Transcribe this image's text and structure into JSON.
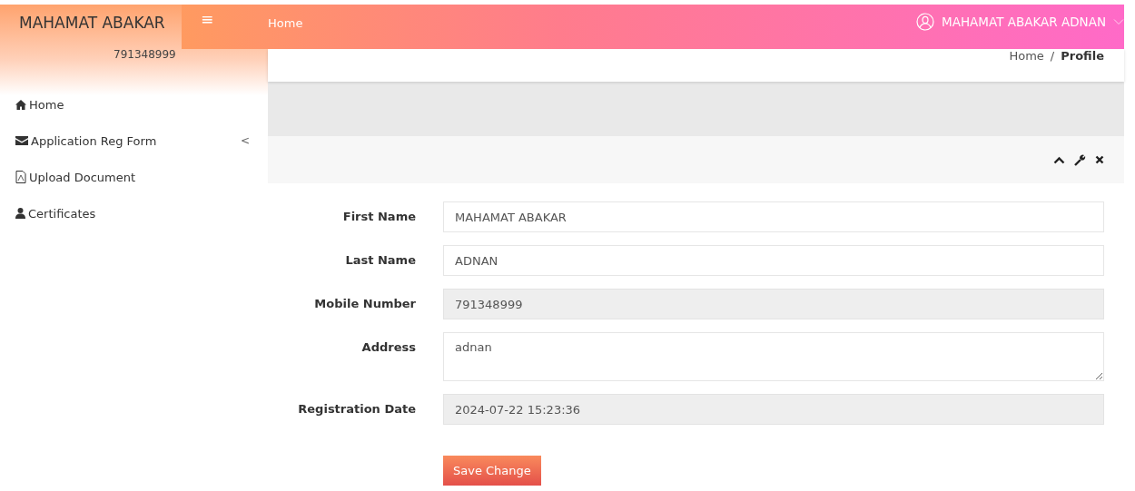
{
  "sidebar": {
    "user_name": "MAHAMAT ABAKAR",
    "user_phone": "791348999",
    "items": [
      {
        "label": "Home"
      },
      {
        "label": "Application Reg Form",
        "submenu_indicator": "<"
      },
      {
        "label": "Upload Document"
      },
      {
        "label": "Certificates"
      }
    ]
  },
  "topbar": {
    "menu_toggle": "≡",
    "title": "Home",
    "user": "MAHAMAT ABAKAR ADNAN"
  },
  "breadcrumb": [
    {
      "label": "Home",
      "selected": false
    },
    {
      "label": "Profile",
      "selected": true
    }
  ],
  "breadcrumb_separator": "/",
  "form": {
    "fields": [
      {
        "kind": "input",
        "label": "First Name",
        "value": "MAHAMAT ABAKAR",
        "disabled": false
      },
      {
        "kind": "input",
        "label": "Last Name",
        "value": "ADNAN",
        "disabled": false
      },
      {
        "kind": "input",
        "label": "Mobile Number",
        "value": "791348999",
        "disabled": true
      },
      {
        "kind": "textarea",
        "label": "Address",
        "value": "adnan",
        "disabled": false
      },
      {
        "kind": "input",
        "label": "Registration Date",
        "value": "2024-07-22 15:23:36",
        "disabled": true
      }
    ],
    "submit": "Save Change"
  }
}
